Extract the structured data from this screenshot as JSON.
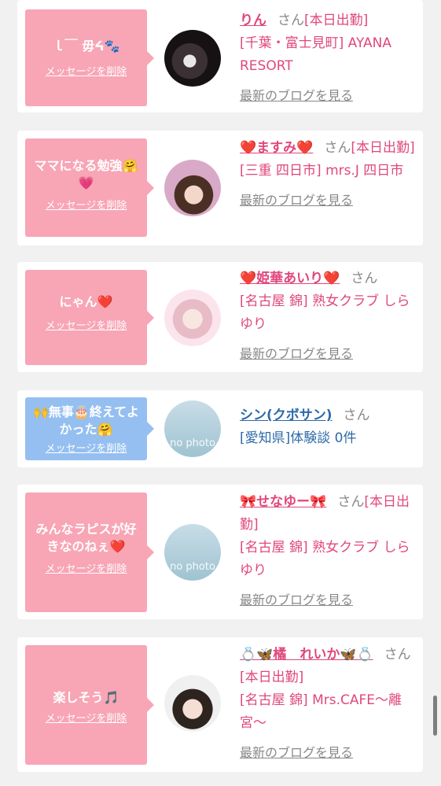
{
  "delete_label": "メッセージを削除",
  "blog_label": "最新のブログを見る",
  "san_label": "さん",
  "colors": {
    "bubble_pink": "#f8a5b5",
    "bubble_blue": "#95bff0",
    "accent_pink": "#e0477d",
    "accent_blue": "#2d6aa8"
  },
  "entries": [
    {
      "message": "ｌ￣ 毋ᔦ🐾",
      "name": "りん",
      "status": "[本日出勤]",
      "shop": "[千葉・富士見町] AYANA RESORT",
      "avatar_icon": "cat-photo"
    },
    {
      "message": "ママになる勉強🤗💗",
      "name": "❤️ますみ❤️",
      "status": "[本日出勤]",
      "shop": "[三重 四日市] mrs.J 四日市",
      "avatar_icon": "woman-photo"
    },
    {
      "message": "にゃん❤️",
      "name": "❤️姫華あいり❤️",
      "status": "",
      "shop": "[名古屋 錦] 熟女クラブ しらゆり",
      "avatar_icon": "woman-photo"
    },
    {
      "message": "🙌無事🎂終えてよかった🤗",
      "name": "シン(クボサン)",
      "status": "",
      "shop": "[愛知県]体験談 0件",
      "avatar_icon": "no-photo",
      "avatar_text": "no photo"
    },
    {
      "message": "みんなラピスが好きなのねぇ❤️",
      "name": "🎀せなゆー🎀",
      "status": "[本日出勤]",
      "shop": "[名古屋 錦] 熟女クラブ しらゆり",
      "avatar_icon": "no-photo",
      "avatar_text": "no photo"
    },
    {
      "message": "楽しそう🎵",
      "name": "💍🦋橘　れいか🦋💍",
      "status": "[本日出勤]",
      "shop": "[名古屋 錦] Mrs.CAFE〜離宮〜",
      "avatar_icon": "woman-photo"
    }
  ]
}
